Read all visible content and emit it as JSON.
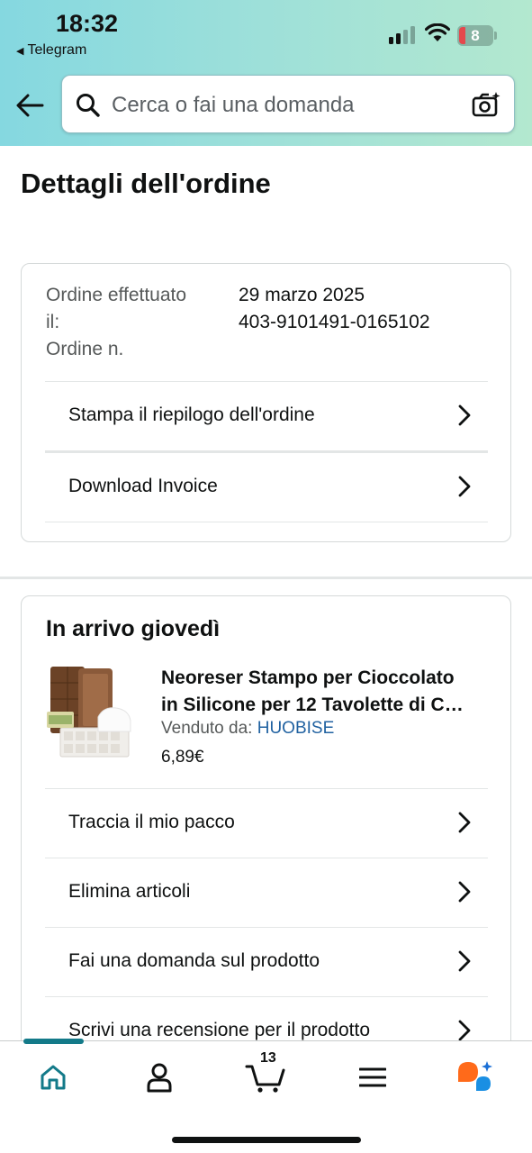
{
  "status_bar": {
    "time": "18:32",
    "back_app": "Telegram",
    "battery": "8"
  },
  "header": {
    "search_placeholder": "Cerca o fai una domanda"
  },
  "page": {
    "title": "Dettagli dell'ordine"
  },
  "summary": {
    "labels": [
      "Ordine effettuato",
      "il:",
      "Ordine n."
    ],
    "order_date": "29 marzo 2025",
    "order_number": "403-9101491-0165102",
    "links": [
      "Stampa il riepilogo dell'ordine",
      "Download Invoice"
    ]
  },
  "shipment": {
    "title": "In arrivo giovedì",
    "product": {
      "title_line1": "Neoreser Stampo per Cioccolato",
      "title_line2": "in Silicone per 12 Tavolette di C…",
      "seller_label": "Venduto da:",
      "seller_name": "HUOBISE",
      "price": "6,89€"
    },
    "actions": [
      "Traccia il mio pacco",
      "Elimina articoli",
      "Fai una domanda sul prodotto",
      "Scrivi una recensione per il prodotto"
    ]
  },
  "bottom_nav": {
    "items": [
      "home-icon",
      "account-icon",
      "cart-icon",
      "menu-icon",
      "rufus-icon"
    ],
    "cart_count": "13",
    "active": "home-icon",
    "accent_color": "#137a89"
  },
  "colors": {
    "link": "#2162a1",
    "header_gradient_start": "#85d8e0",
    "header_gradient_end": "#b3e8cf"
  }
}
